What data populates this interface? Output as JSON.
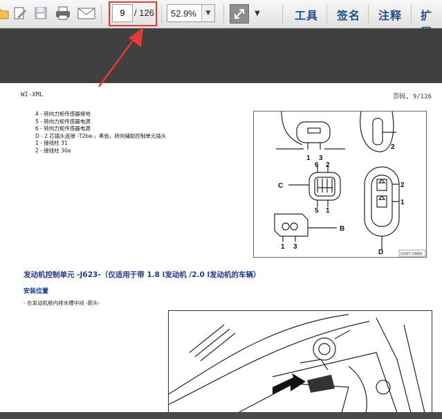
{
  "toolbar": {
    "page_current": "9",
    "page_total": "/ 126",
    "zoom": "52.9%",
    "menus": [
      "工具",
      "签名",
      "注释",
      "扩展"
    ]
  },
  "document": {
    "header_left": "WI-XML",
    "header_right": "页码, 9/126",
    "legend": [
      "4 - 转向力矩传感器接地",
      "5 - 转向力矩传感器电源",
      "6 - 转向力矩传感器电源",
      "D - 2 芯插头连接 -T2ba-，黑色，转向辅助控制单元插头",
      "1 - 接线柱 31",
      "2 - 接线柱 30a"
    ],
    "diagram_labels": {
      "top_pins": [
        "1",
        "3"
      ],
      "top_right": "2",
      "c_label": "C",
      "c_top": [
        "6",
        "2"
      ],
      "c_bottom": [
        "5",
        "1"
      ],
      "b_label": "B",
      "b_bottom": [
        "1",
        "3"
      ],
      "d_label": "D",
      "d_pins": [
        "2",
        "1"
      ],
      "code": "CH97-10884"
    },
    "section_title": "发动机控制单元 -J623-（仅适用于带 1.8 l发动机 /2.0 l发动机的车辆）",
    "subtitle": "安装位置",
    "body_text": "- 在发动机舱内排水槽中间 -箭头-"
  },
  "colors": {
    "annotation_red": "#e53935",
    "menu_blue": "#1f4e86",
    "title_blue": "#1f3a8a"
  },
  "icons": [
    "folder-icon",
    "edit-icon",
    "save-icon",
    "print-icon",
    "email-icon",
    "fit-page-icon",
    "more-icon"
  ]
}
